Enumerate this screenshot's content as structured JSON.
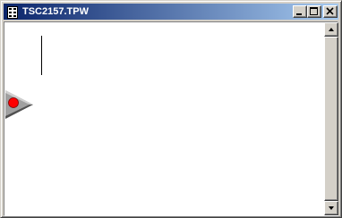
{
  "window": {
    "title": "TSC2157.TPW",
    "icon": "document-icon",
    "controls": {
      "minimize_icon": "minimize-icon",
      "maximize_icon": "maximize-icon",
      "close_icon": "close-icon"
    }
  },
  "canvas": {
    "marker_icon": "play-marker-icon",
    "marker_colors": {
      "triangle": "#808080",
      "dot": "#ff0000"
    },
    "caret_icon": "text-caret"
  },
  "scrollbar": {
    "up_icon": "arrow-up-icon",
    "down_icon": "arrow-down-icon"
  },
  "colors": {
    "titlebar_start": "#0a246a",
    "titlebar_end": "#a6caf0",
    "face": "#d4d0c8",
    "client_background": "#ffffff"
  }
}
